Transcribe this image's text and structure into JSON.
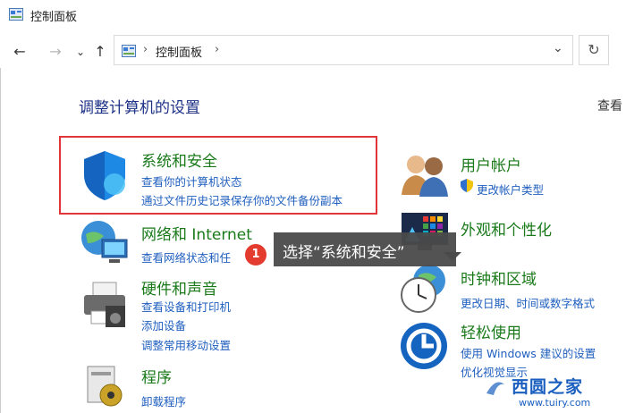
{
  "window": {
    "title": "控制面板"
  },
  "nav": {
    "back": "←",
    "forward": "→",
    "recent": "⌄",
    "up": "↑",
    "address": "控制面板",
    "sep": "›",
    "dropdown": "⌄",
    "refresh": "↻"
  },
  "header": {
    "title": "调整计算机的设置",
    "view_by": "查看"
  },
  "categories": {
    "system_security": {
      "title": "系统和安全",
      "links": [
        "查看你的计算机状态",
        "通过文件历史记录保存你的文件备份副本"
      ]
    },
    "network": {
      "title": "网络和 Internet",
      "links": [
        "查看网络状态和任"
      ]
    },
    "hardware": {
      "title": "硬件和声音",
      "links": [
        "查看设备和打印机",
        "添加设备",
        "调整常用移动设置"
      ]
    },
    "programs": {
      "title": "程序",
      "links": [
        "卸载程序"
      ]
    },
    "user_accounts": {
      "title": "用户帐户",
      "links": [
        "更改帐户类型"
      ]
    },
    "appearance": {
      "title": "外观和个性化",
      "links": []
    },
    "clock_region": {
      "title": "时钟和区域",
      "links": [
        "更改日期、时间或数字格式"
      ]
    },
    "ease_access": {
      "title": "轻松使用",
      "links": [
        "使用 Windows 建议的设置",
        "优化视觉显示"
      ]
    }
  },
  "annotation": {
    "step": "1",
    "text": "选择“系统和安全”"
  },
  "watermark": {
    "site": "西圆之家",
    "url": "www.tuiry.com"
  },
  "colors": {
    "highlight": "#e0363a",
    "category_title": "#1a7a1a",
    "link": "#1f5fbf",
    "page_title": "#1e3287"
  }
}
